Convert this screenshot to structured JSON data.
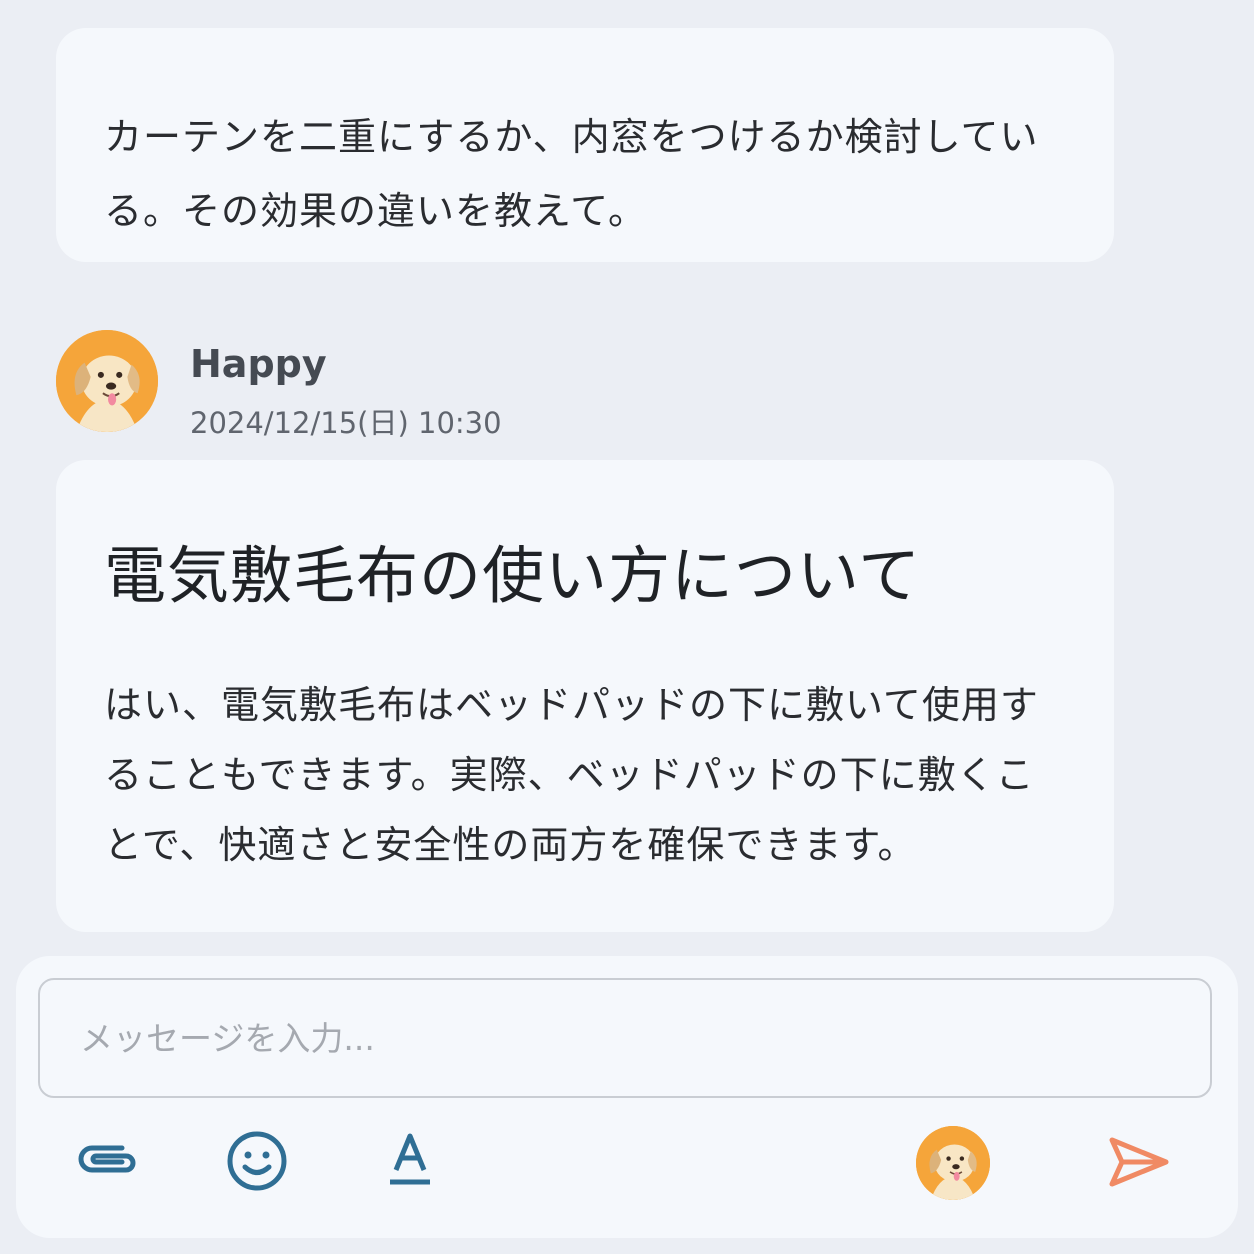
{
  "conversation": {
    "user_message": "カーテンを二重にするか、内窓をつけるか検討している。その効果の違いを教えて。",
    "assistant": {
      "name": "Happy",
      "timestamp": "2024/12/15(日) 10:30",
      "title": "電気敷毛布の使い方について",
      "body": "はい、電気敷毛布はベッドパッドの下に敷いて使用することもできます。実際、ベッドパッドの下に敷くことで、快適さと安全性の両方を確保できます。"
    }
  },
  "composer": {
    "placeholder": "メッセージを入力...",
    "value": "",
    "toolbar": [
      {
        "icon": "paperclip-icon",
        "color": "#2f6e94"
      },
      {
        "icon": "smiley-icon",
        "color": "#2f6e94"
      },
      {
        "icon": "text-format-icon",
        "color": "#2f6e94"
      },
      {
        "icon": "avatar-icon"
      },
      {
        "icon": "send-icon",
        "color": "#f08a64"
      }
    ]
  },
  "colors": {
    "background": "#ebeef4",
    "bubble": "#f5f8fc",
    "accent": "#2f6e94",
    "send": "#f08a64",
    "avatar_bg": "#f5a53a"
  }
}
